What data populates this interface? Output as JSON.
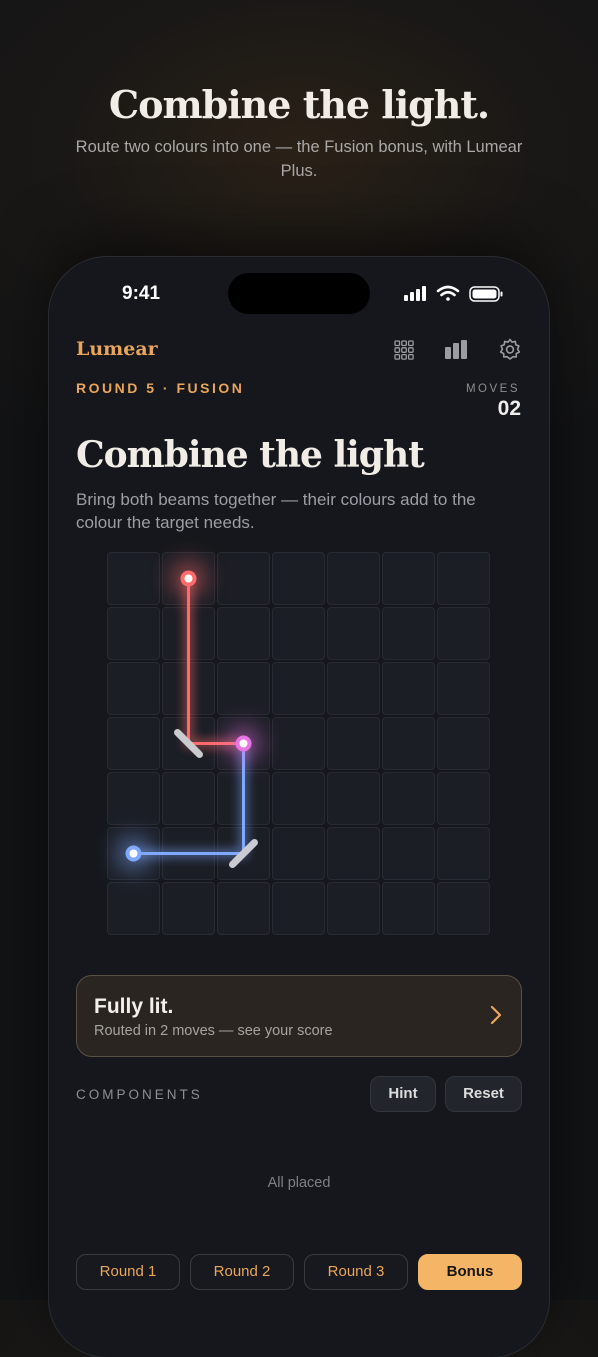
{
  "hero": {
    "title": "Combine the light.",
    "subtitle": "Route two colours into one — the Fusion bonus, with Lumear Plus."
  },
  "status_bar": {
    "time": "9:41",
    "icons": [
      "signal-icon",
      "wifi-icon",
      "battery-icon"
    ]
  },
  "header": {
    "app_name": "Lumear",
    "icons": [
      "grid-icon",
      "stats-icon",
      "settings-icon"
    ]
  },
  "round": {
    "label": "ROUND 5 · FUSION",
    "moves_label": "MOVES",
    "moves_value": "02"
  },
  "level": {
    "title": "Combine the light",
    "description": "Bring both beams together — their colours add to the colour the target needs."
  },
  "board": {
    "cols": 7,
    "rows": 7,
    "sources": [
      {
        "color": "red",
        "cell": [
          1,
          0
        ]
      },
      {
        "color": "blue",
        "cell": [
          0,
          5
        ]
      }
    ],
    "target": {
      "color": "magenta",
      "cell": [
        2,
        3
      ]
    },
    "mirrors": [
      {
        "cell": [
          1,
          3
        ],
        "orientation": "\\"
      },
      {
        "cell": [
          2,
          5
        ],
        "orientation": "/"
      }
    ],
    "beams": [
      {
        "color": "red",
        "path": [
          [
            1,
            0
          ],
          [
            1,
            3
          ],
          [
            2,
            3
          ]
        ]
      },
      {
        "color": "blue",
        "path": [
          [
            0,
            5
          ],
          [
            2,
            5
          ],
          [
            2,
            3
          ]
        ]
      }
    ],
    "colors": {
      "red": "#ff6b6b",
      "blue": "#7fa8ff",
      "magenta": "#e875e6"
    }
  },
  "result": {
    "title": "Fully lit.",
    "subtitle": "Routed in 2 moves — see your score"
  },
  "components": {
    "label": "COMPONENTS",
    "hint_label": "Hint",
    "reset_label": "Reset",
    "empty_text": "All placed"
  },
  "tabs": [
    {
      "label": "Round 1",
      "active": false
    },
    {
      "label": "Round 2",
      "active": false
    },
    {
      "label": "Round 3",
      "active": false
    },
    {
      "label": "Bonus",
      "active": true
    }
  ],
  "accent_color": "#e9a65b"
}
